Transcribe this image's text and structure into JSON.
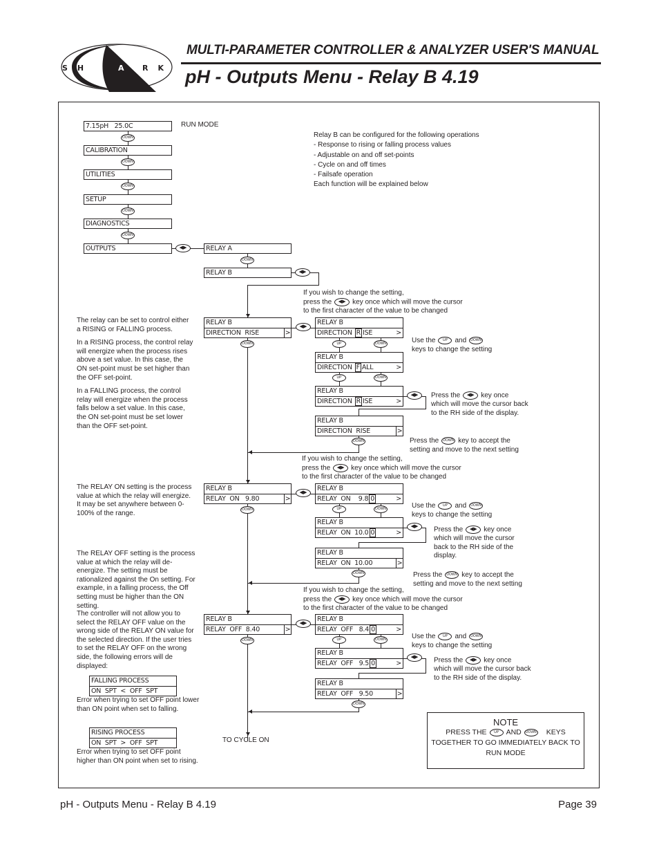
{
  "header": {
    "logo_text": "SHARK",
    "manual_title": "MULTI-PARAMETER CONTROLLER & ANALYZER USER'S MANUAL",
    "page_title": "pH - Outputs Menu - Relay B 4.19"
  },
  "footer": {
    "section": "pH - Outputs Menu - Relay B 4.19",
    "page": "Page 39"
  },
  "keys": {
    "down": "DOWN",
    "up": "UP",
    "leftright": "◀▶"
  },
  "main_menu": {
    "items": [
      "7.15pH   25.0C",
      "CALIBRATION",
      "UTILITIES",
      "SETUP",
      "DIAGNOSTICS",
      "OUTPUTS"
    ],
    "run_mode_label": "RUN MODE"
  },
  "outputs_menu": {
    "items": [
      "RELAY A",
      "RELAY B"
    ]
  },
  "intro": {
    "lines": [
      "Relay B can be configured for the following operations",
      "- Response to rising or falling process values",
      "- Adjustable on and off set-points",
      "- Cycle on and off times",
      "- Failsafe operation",
      "Each function will be explained below"
    ]
  },
  "instructions": {
    "change_1": "If you wish to change the setting,",
    "change_2a": "press the",
    "change_2b": "key once which will move the cursor",
    "change_3": "to the first character of the value to be changed",
    "use_a": "Use the",
    "use_and": "and",
    "use_b": "keys to change the setting",
    "press_the": "Press the",
    "key_once": "key once",
    "cursor_back_1": "which will move the cursor back",
    "cursor_back_2": "to the RH side of the display.",
    "cursor_alt_1": "which will move the cursor",
    "cursor_alt_2": "back to the RH side of the",
    "cursor_alt_3": "display.",
    "accept_b": "key to accept the",
    "accept_2": "setting and move to the next setting",
    "to_cycle_on": "TO CYCLE ON"
  },
  "direction": {
    "description": [
      "The relay can be set to control either a RISING or FALLING process.",
      "In a RISING process, the control relay will energize when the process rises above a set value. In this case, the ON set-point must be set higher than the OFF set-point.",
      "In a FALLING process, the control relay will energize when the process falls below a set value. In this case, the ON set-point must be set lower than the OFF set-point."
    ],
    "title": "RELAY B",
    "main_label": "DIRECTION  RISE",
    "steps": [
      {
        "prefix": "DIRECTION ",
        "cursor": "R",
        "suffix": "ISE"
      },
      {
        "prefix": "DIRECTION ",
        "cursor": "F",
        "suffix": "ALL"
      },
      {
        "prefix": "DIRECTION ",
        "cursor": "R",
        "suffix": "ISE"
      }
    ],
    "final": "DIRECTION  RISE"
  },
  "relay_on": {
    "description": "The RELAY ON setting is the process value at which the relay will energize. It may be set anywhere between 0-100% of the range.",
    "title": "RELAY B",
    "main_label": "RELAY  ON   9.80",
    "steps": [
      {
        "prefix": "RELAY  ON    9.8",
        "cursor": "0",
        "suffix": ""
      },
      {
        "prefix": "RELAY  ON  10.0",
        "cursor": "0",
        "suffix": ""
      }
    ],
    "final": "RELAY  ON  10.00"
  },
  "relay_off": {
    "description": "The RELAY OFF setting is the process value at which the relay will de-energize. The setting must be rationalized against the On setting. For example, in a falling process, the Off setting must be higher than the ON setting.",
    "description2": "The controller will not allow you to select the RELAY OFF value on the wrong side of the RELAY ON value for the selected direction. If the user tries to set the RELAY OFF on the wrong side, the following errors will de displayed:",
    "title": "RELAY B",
    "main_label": "RELAY  OFF  8.40",
    "steps": [
      {
        "prefix": "RELAY  OFF   8.4",
        "cursor": "0",
        "suffix": ""
      },
      {
        "prefix": "RELAY  OFF   9.5",
        "cursor": "0",
        "suffix": ""
      }
    ],
    "final": "RELAY  OFF   9.50"
  },
  "errors": [
    {
      "line1": "FALLING PROCESS",
      "line2": "ON  SPT  <  OFF  SPT",
      "caption": "Error when trying to set OFF point lower than ON point when set to falling."
    },
    {
      "line1": "RISING PROCESS",
      "line2": "ON  SPT  >  OFF  SPT",
      "caption": "Error when trying to set OFF point higher than ON point when set to rising."
    }
  ],
  "note": {
    "title": "NOTE",
    "line1a": "PRESS THE",
    "line1b": "AND",
    "line1c": "KEYS",
    "line2": "TOGETHER TO GO IMMEDIATELY BACK TO",
    "line3": "RUN MODE"
  }
}
